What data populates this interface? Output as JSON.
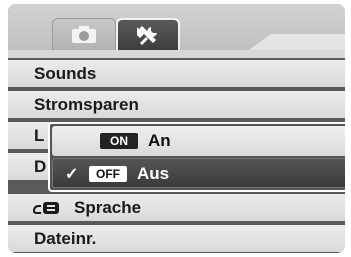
{
  "tabs": [
    {
      "name": "camera",
      "icon": "camera-icon"
    },
    {
      "name": "setup",
      "icon": "wrench-icon",
      "active": true
    }
  ],
  "menu": {
    "items": [
      {
        "label": "Sounds"
      },
      {
        "label": "Stromsparen"
      },
      {
        "label": "L"
      },
      {
        "label": "D"
      },
      {
        "label": "Sprache",
        "icon": "language-icon"
      },
      {
        "label": "Dateinr."
      }
    ]
  },
  "submenu": {
    "options": [
      {
        "badge": "ON",
        "label": "An",
        "selected": false
      },
      {
        "badge": "OFF",
        "label": "Aus",
        "selected": true,
        "check": "✓"
      }
    ]
  },
  "colors": {
    "frame": "#5a5a5a",
    "row": "#e3e3e3",
    "selected_option": "#444444",
    "accent_border": "#ffffff"
  }
}
